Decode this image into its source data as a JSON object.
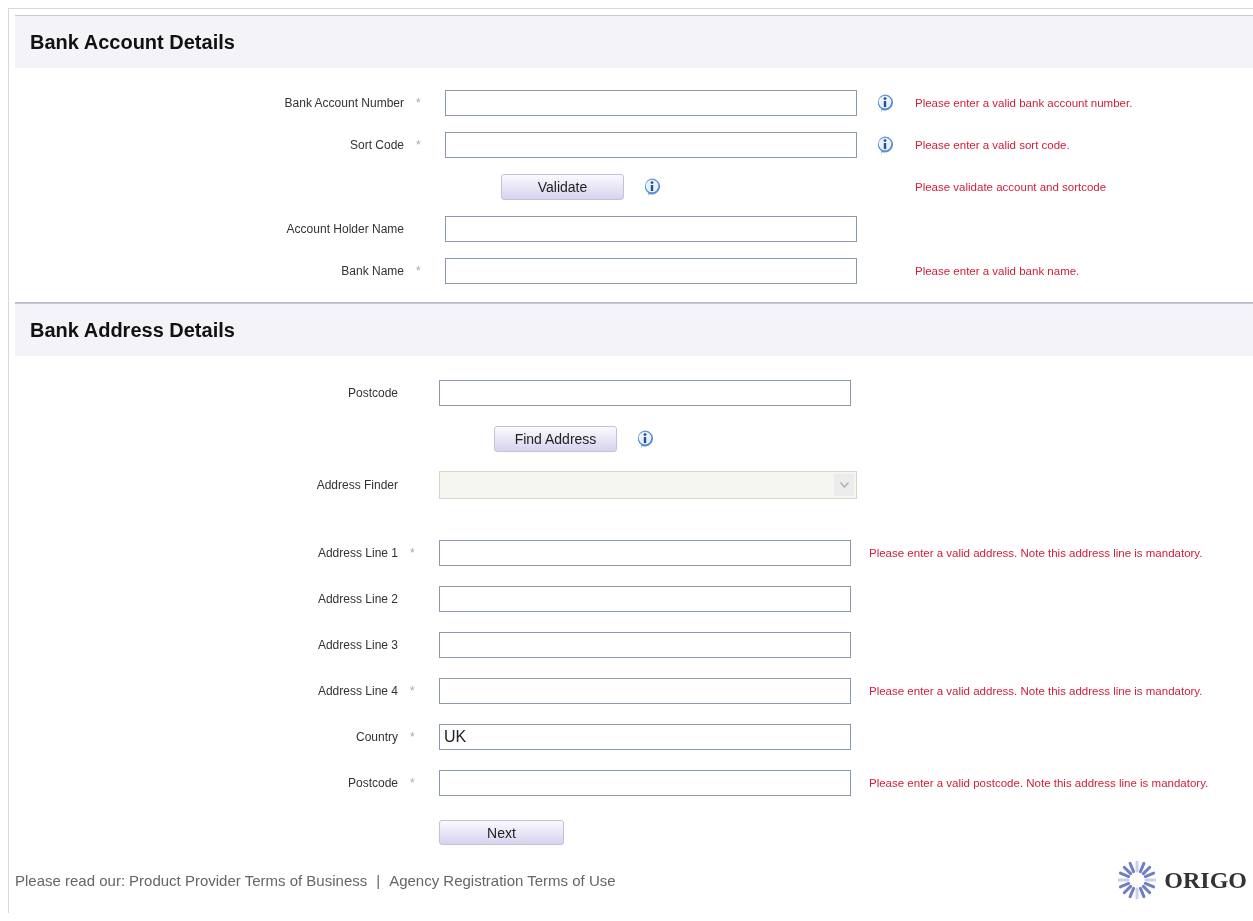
{
  "sections": [
    {
      "title": "Bank Account Details",
      "rows": [
        {
          "kind": "field",
          "label": "Bank Account Number",
          "required": true,
          "value": "",
          "info": true,
          "error": "Please enter a valid bank account number."
        },
        {
          "kind": "field",
          "label": "Sort Code",
          "required": true,
          "value": "",
          "info": true,
          "error": "Please enter a valid sort code."
        },
        {
          "kind": "button",
          "label": "Validate",
          "info": true,
          "error": "Please validate account and sortcode"
        },
        {
          "kind": "field",
          "label": "Account Holder Name",
          "value": ""
        },
        {
          "kind": "field",
          "label": "Bank Name",
          "required": true,
          "value": "",
          "error": "Please enter a valid bank name."
        }
      ]
    },
    {
      "title": "Bank Address Details",
      "rows": [
        {
          "kind": "field",
          "label": "Postcode",
          "value": ""
        },
        {
          "kind": "button",
          "label": "Find Address",
          "info": true
        },
        {
          "kind": "select",
          "label": "Address Finder",
          "disabled": true
        },
        {
          "kind": "field",
          "label": "Address Line 1",
          "required": true,
          "value": "",
          "error": "Please enter a valid address. Note this address line is mandatory."
        },
        {
          "kind": "field",
          "label": "Address Line 2",
          "value": ""
        },
        {
          "kind": "field",
          "label": "Address Line 3",
          "value": ""
        },
        {
          "kind": "field",
          "label": "Address Line 4",
          "required": true,
          "value": "",
          "error": "Please enter a valid address. Note this address line is mandatory."
        },
        {
          "kind": "field",
          "label": "Country",
          "required": true,
          "value": "UK"
        },
        {
          "kind": "field",
          "label": "Postcode",
          "required": true,
          "value": "",
          "error": "Please enter a valid postcode. Note this address line is mandatory."
        }
      ]
    }
  ],
  "required_mark": "*",
  "next_button": "Next",
  "footer": {
    "intro": "Please read our:",
    "links": [
      "Product Provider Terms of Business",
      "Agency Registration Terms of Use"
    ],
    "separator": "|"
  },
  "logo": "ORIGO"
}
